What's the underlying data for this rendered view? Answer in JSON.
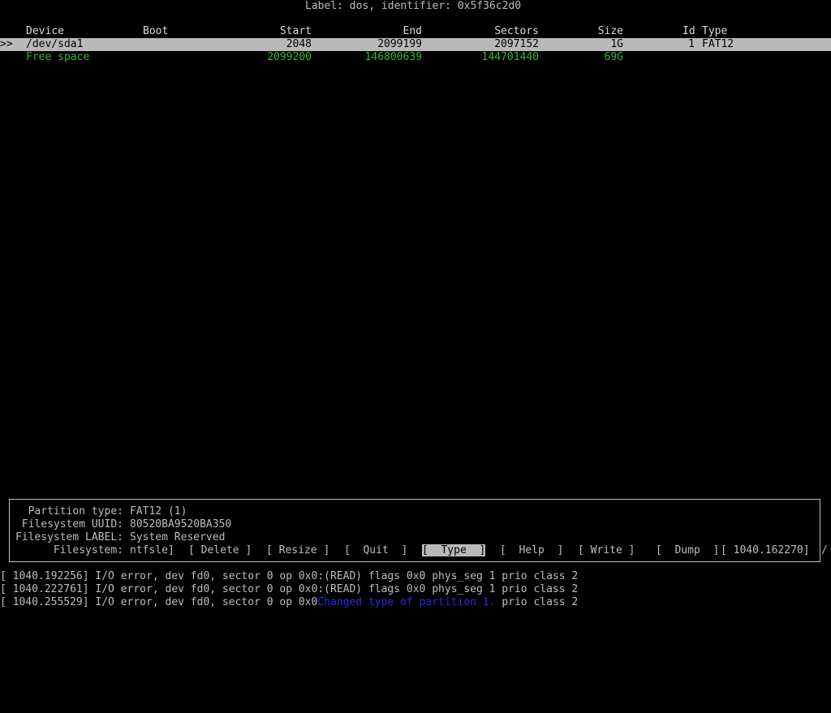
{
  "label_line": "Label: dos, identifier: 0x5f36c2d0",
  "columns": {
    "device": "Device",
    "boot": "Boot",
    "start": "Start",
    "end": "End",
    "sectors": "Sectors",
    "size": "Size",
    "id": "Id",
    "type": "Type"
  },
  "rows": [
    {
      "marker": ">>",
      "device": "/dev/sda1",
      "boot": "",
      "start": "2048",
      "end": "2099199",
      "sectors": "2097152",
      "size": "1G",
      "id": "1",
      "type": "FAT12",
      "selected": true
    },
    {
      "marker": "",
      "device": "Free space",
      "start": "2099200",
      "end": "146800639",
      "sectors": "144701440",
      "size": "69G"
    }
  ],
  "info": {
    "partition_type_label": "Partition type:",
    "partition_type_value": "FAT12 (1)",
    "uuid_label": "Filesystem UUID:",
    "uuid_value": "80520BA9520BA350",
    "fs_label_label": "Filesystem LABEL:",
    "fs_label_value": "System Reserved",
    "filesystem_label": "Filesystem:",
    "filesystem_value": "ntfsle]"
  },
  "menu": {
    "delete": "Delete",
    "resize": "Resize",
    "quit": "Quit",
    "type": "Type",
    "help": "Help",
    "write": "Write",
    "dump": "Dump",
    "overlay_timestamp": "[ 1040.162270]",
    "overlay_tail": "/",
    "active": "type"
  },
  "log": [
    {
      "text": "[ 1040.192256] I/O error, dev fd0, sector 0 op 0x0:(READ) flags 0x0 phys_seg 1 prio class 2"
    },
    {
      "text": "[ 1040.222761] I/O error, dev fd0, sector 0 op 0x0:(READ) flags 0x0 phys_seg 1 prio class 2"
    },
    {
      "pre": "[ 1040.255529] I/O error, dev fd0, sector 0 op 0x0",
      "overlay": "Changed type of partition 1.",
      "post": " prio class 2"
    }
  ],
  "colors": {
    "background": "#000000",
    "text": "#bdbdbd",
    "selection": "#b9b9b9",
    "free_space": "#35b335",
    "status_message": "#2a2ae0"
  }
}
